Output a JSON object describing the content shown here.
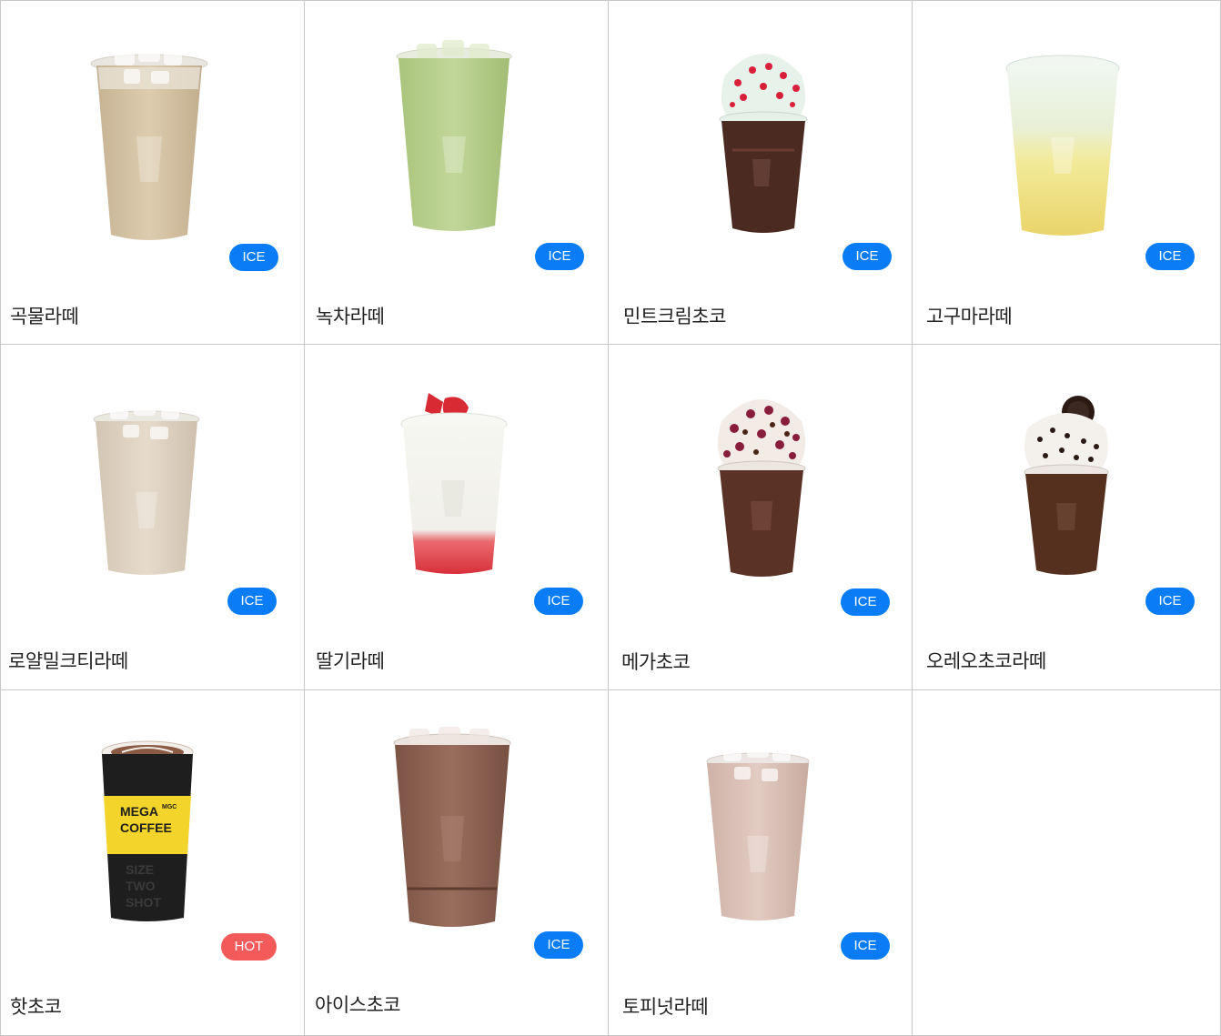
{
  "colors": {
    "ice_badge": "#0a7df6",
    "hot_badge": "#f35b5b",
    "grid_line": "#c8c8c8"
  },
  "products": [
    {
      "name": "곡물라떼",
      "temp": "ICE",
      "drink": "grain-latte-icon"
    },
    {
      "name": "녹차라떼",
      "temp": "ICE",
      "drink": "green-tea-latte-icon"
    },
    {
      "name": "민트크림초코",
      "temp": "ICE",
      "drink": "mint-cream-choco-icon"
    },
    {
      "name": "고구마라떼",
      "temp": "ICE",
      "drink": "sweet-potato-latte-icon"
    },
    {
      "name": "로얄밀크티라떼",
      "temp": "ICE",
      "drink": "royal-milk-tea-latte-icon"
    },
    {
      "name": "딸기라떼",
      "temp": "ICE",
      "drink": "strawberry-latte-icon"
    },
    {
      "name": "메가초코",
      "temp": "ICE",
      "drink": "mega-choco-icon"
    },
    {
      "name": "오레오초코라떼",
      "temp": "ICE",
      "drink": "oreo-choco-latte-icon"
    },
    {
      "name": "핫초코",
      "temp": "HOT",
      "drink": "hot-choco-cup-icon"
    },
    {
      "name": "아이스초코",
      "temp": "ICE",
      "drink": "iced-choco-icon"
    },
    {
      "name": "토피넛라떼",
      "temp": "ICE",
      "drink": "toffee-nut-latte-icon"
    }
  ],
  "hot_cup_text": {
    "brand_line1": "MEGA",
    "brand_line2": "COFFEE",
    "brand_mini": "MGC",
    "bottom_line1": "SIZE",
    "bottom_line2": "TWO",
    "bottom_line3": "SHOT"
  }
}
